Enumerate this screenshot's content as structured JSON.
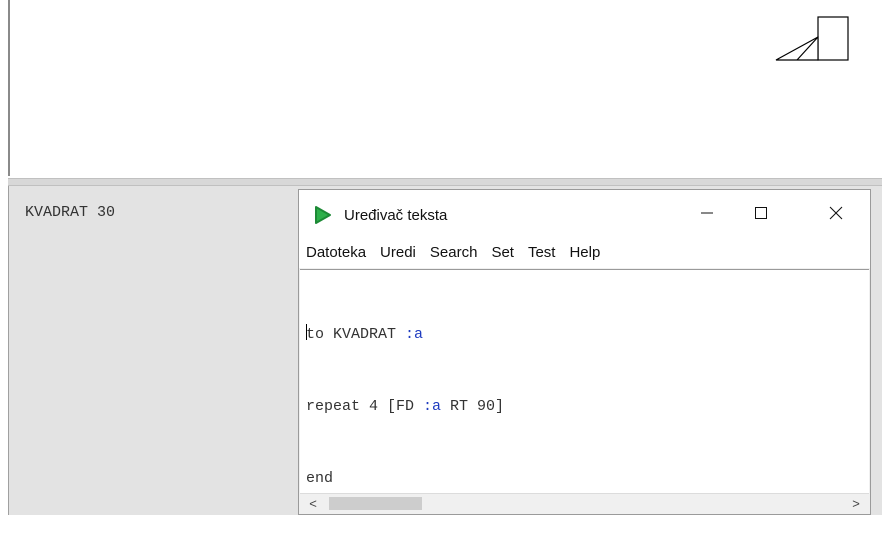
{
  "command_panel": {
    "text": "KVADRAT 30"
  },
  "editor": {
    "title": "Uređivač teksta",
    "window_buttons": {
      "minimize": "—",
      "maximize": "☐",
      "close": "✕"
    },
    "menu": [
      "Datoteka",
      "Uredi",
      "Search",
      "Set",
      "Test",
      "Help"
    ],
    "code_lines": [
      [
        {
          "text": "to KVADRAT ",
          "kind": "plain"
        },
        {
          "text": ":a",
          "kind": "param"
        }
      ],
      [
        {
          "text": "repeat 4 [FD ",
          "kind": "plain"
        },
        {
          "text": ":a",
          "kind": "param"
        },
        {
          "text": " RT 90]",
          "kind": "plain"
        }
      ],
      [
        {
          "text": "end",
          "kind": "plain"
        }
      ]
    ],
    "scrollbar": {
      "left_arrow": "<",
      "right_arrow": ">"
    }
  },
  "icons": {
    "app": "green-play-icon"
  },
  "colors": {
    "app_icon": "#2db04a",
    "param": "#1f3cc0"
  }
}
